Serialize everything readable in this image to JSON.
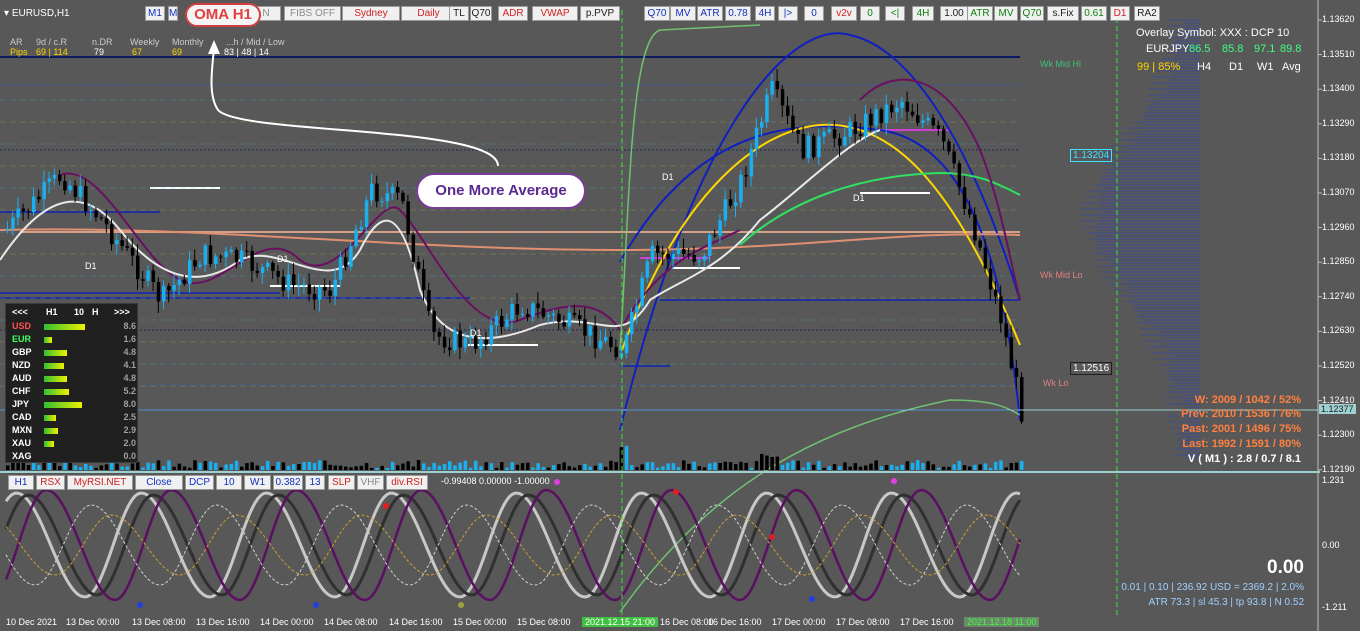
{
  "window": {
    "symbol_tf": "EURUSD,H1"
  },
  "toolbar_top": [
    {
      "label": "M1",
      "cls": ""
    },
    {
      "label": "M",
      "cls": ""
    },
    {
      "label": "N",
      "cls": "gray"
    },
    {
      "label": "FIBS OFF",
      "cls": "gray"
    },
    {
      "label": "Sydney",
      "cls": "red"
    },
    {
      "label": "Daily",
      "cls": "red"
    },
    {
      "label": "TL",
      "cls": "dark"
    },
    {
      "label": "Q70",
      "cls": "dark"
    },
    {
      "label": "ADR",
      "cls": "red"
    },
    {
      "label": "VWAP",
      "cls": "red"
    },
    {
      "label": "p.PVP",
      "cls": "dark"
    },
    {
      "label": "Q70",
      "cls": ""
    },
    {
      "label": "MV",
      "cls": ""
    },
    {
      "label": "ATR",
      "cls": ""
    },
    {
      "label": "0.78",
      "cls": ""
    },
    {
      "label": "4H",
      "cls": ""
    },
    {
      "label": "|>",
      "cls": ""
    },
    {
      "label": "0",
      "cls": ""
    },
    {
      "label": "v2v",
      "cls": "red"
    },
    {
      "label": "0",
      "cls": "grn"
    },
    {
      "label": "<|",
      "cls": "grn"
    },
    {
      "label": "4H",
      "cls": "grn"
    },
    {
      "label": "1.00",
      "cls": "dark"
    },
    {
      "label": "ATR",
      "cls": "grn"
    },
    {
      "label": "MV",
      "cls": "grn"
    },
    {
      "label": "Q70",
      "cls": "grn"
    },
    {
      "label": "s.Fix",
      "cls": "dark"
    },
    {
      "label": "0.61",
      "cls": "grn"
    },
    {
      "label": "D1",
      "cls": "red"
    },
    {
      "label": "RA2",
      "cls": "dark"
    }
  ],
  "oma_badge": "OMA H1",
  "callout_text": "One More Average",
  "adr_table": {
    "row1": [
      "AR",
      "9d / c.R",
      "n.DR",
      "Weekly",
      "Monthly",
      "...h / Mid / Low"
    ],
    "row2": [
      "Pips",
      "69 | 114",
      "79",
      "67",
      "69",
      "83 | 48 | 14"
    ]
  },
  "overlay": {
    "title": "Overlay Symbol: XXX : DCP 10",
    "symbol": "EURJPY",
    "values": [
      "86.5",
      "85.8",
      "97.1",
      "89.8"
    ],
    "pct": "99 | 85%",
    "cols": [
      "H4",
      "D1",
      "W1",
      "Avg"
    ]
  },
  "levels": {
    "wk_mid_hi": "Wk Mid Hi",
    "wk_mid_lo": "Wk Mid Lo",
    "wk_lo": "Wk Lo",
    "d1": "D1"
  },
  "price_tags": {
    "box1": "1.13204",
    "box2": "1.12516",
    "current": "1.12377"
  },
  "price_axis": [
    "1.13620",
    "1.13510",
    "1.13400",
    "1.13290",
    "1.13180",
    "1.13070",
    "1.12960",
    "1.12850",
    "1.12740",
    "1.12630",
    "1.12520",
    "1.12410",
    "1.12300",
    "1.12190"
  ],
  "stats": {
    "w": "W: 2009 / 1042 / 52%",
    "prev": "Prev: 2010 / 1536 / 76%",
    "past": "Past: 2001 / 1496 / 75%",
    "last": "Last: 1992 / 1591 / 80%",
    "vm1": "V ( M1 ) : 2.8 / 0.7 / 8.1"
  },
  "strength": {
    "header": [
      "<<<",
      "H1",
      "10",
      "H",
      ">>>"
    ],
    "rows": [
      {
        "cur": "USD",
        "val": "8.6",
        "color": "#ff5050"
      },
      {
        "cur": "EUR",
        "val": "1.6",
        "color": "#40ff60"
      },
      {
        "cur": "GBP",
        "val": "4.8",
        "color": "#ffffff"
      },
      {
        "cur": "NZD",
        "val": "4.1",
        "color": "#ffffff"
      },
      {
        "cur": "AUD",
        "val": "4.8",
        "color": "#ffffff"
      },
      {
        "cur": "CHF",
        "val": "5.2",
        "color": "#ffffff"
      },
      {
        "cur": "JPY",
        "val": "8.0",
        "color": "#ffffff"
      },
      {
        "cur": "CAD",
        "val": "2.5",
        "color": "#ffffff"
      },
      {
        "cur": "MXN",
        "val": "2.9",
        "color": "#ffffff"
      },
      {
        "cur": "XAU",
        "val": "2.0",
        "color": "#ffffff"
      },
      {
        "cur": "XAG",
        "val": "0.0",
        "color": "#ffffff"
      }
    ]
  },
  "toolbar_bottom": [
    {
      "label": "H1",
      "cls": ""
    },
    {
      "label": "RSX",
      "cls": "red"
    },
    {
      "label": "MyRSI.NET",
      "cls": "red"
    },
    {
      "label": "Close",
      "cls": ""
    },
    {
      "label": "DCP",
      "cls": ""
    },
    {
      "label": "10",
      "cls": ""
    },
    {
      "label": "W1",
      "cls": ""
    },
    {
      "label": "0.382",
      "cls": ""
    },
    {
      "label": "13",
      "cls": ""
    },
    {
      "label": "SLP",
      "cls": "red"
    },
    {
      "label": "VHF",
      "cls": "gray"
    },
    {
      "label": "div.RSI",
      "cls": "red"
    }
  ],
  "osc": {
    "readout": "-0.99408 0.00000 -1.00000",
    "big_value": "0.00",
    "line1": "0.01  |  0.10  |  236.92 USD = 2369.2  |  2.0%",
    "line2": "ATR 73.3  | sl 45.3  |  tp 93.8  |  N 0.52",
    "axis": [
      "1.231",
      "0.00",
      "-1.211"
    ]
  },
  "date_axis": [
    "10 Dec 2021",
    "13 Dec 00:00",
    "13 Dec 08:00",
    "13 Dec 16:00",
    "14 Dec 00:00",
    "14 Dec 08:00",
    "14 Dec 16:00",
    "15 Dec 00:00",
    "15 Dec 08:00",
    "2021.12.15 21:00",
    "16 Dec 08:00",
    "16 Dec 16:00",
    "17 Dec 00:00",
    "17 Dec 08:00",
    "17 Dec 16:00",
    "2021.12.18 11:00"
  ],
  "colors": {
    "bg": "#585858",
    "bull": "#1ab0f0",
    "bear": "#000000",
    "navy": "#0a1a60",
    "yellow": "#ffd700",
    "purple": "#6a1060",
    "green": "#30e060"
  }
}
